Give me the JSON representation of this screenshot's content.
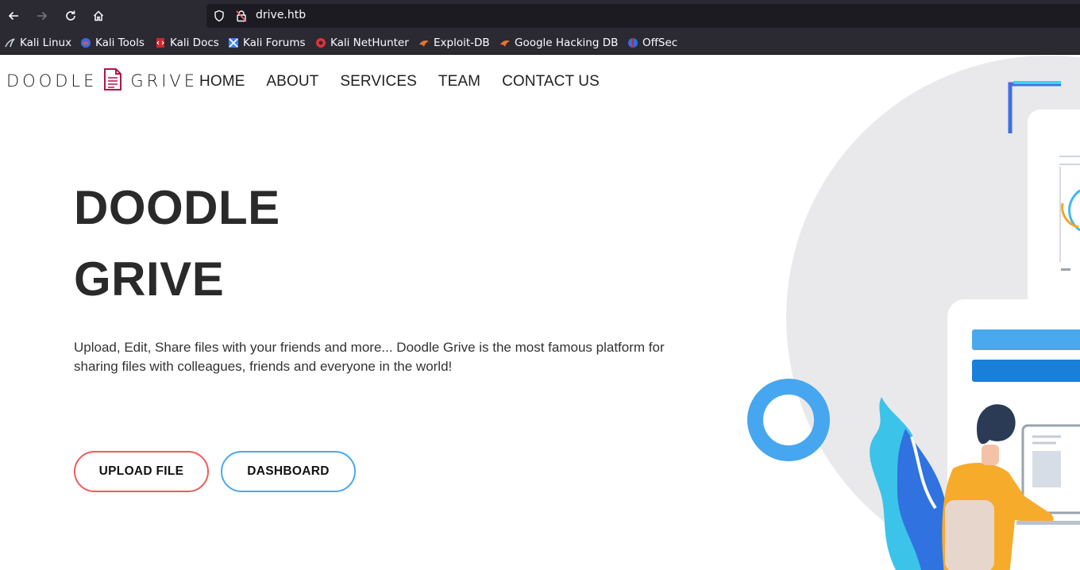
{
  "browser": {
    "url": "drive.htb",
    "bookmarks": [
      {
        "label": "Kali Linux",
        "icon": "kali-dragon-icon"
      },
      {
        "label": "Kali Tools",
        "icon": "kali-tools-icon"
      },
      {
        "label": "Kali Docs",
        "icon": "kali-docs-icon"
      },
      {
        "label": "Kali Forums",
        "icon": "kali-forums-icon"
      },
      {
        "label": "Kali NetHunter",
        "icon": "kali-nethunter-icon"
      },
      {
        "label": "Exploit-DB",
        "icon": "exploit-db-icon"
      },
      {
        "label": "Google Hacking DB",
        "icon": "ghdb-icon"
      },
      {
        "label": "OffSec",
        "icon": "offsec-icon"
      }
    ]
  },
  "site": {
    "logo_left": "DOODLE",
    "logo_right": "GRIVE",
    "nav": [
      "HOME",
      "ABOUT",
      "SERVICES",
      "TEAM",
      "CONTACT US"
    ],
    "hero_line1": "DOODLE",
    "hero_line2": "GRIVE",
    "description": "Upload, Edit, Share files with your friends and more... Doodle Grive is the most famous platform for sharing files with colleagues, friends and everyone in the world!",
    "upload_label": "UPLOAD FILE",
    "dashboard_label": "DASHBOARD"
  },
  "colors": {
    "accent_red": "#ef5b5b",
    "accent_blue": "#4aa8ee",
    "chrome_bg": "#2b2a33"
  }
}
